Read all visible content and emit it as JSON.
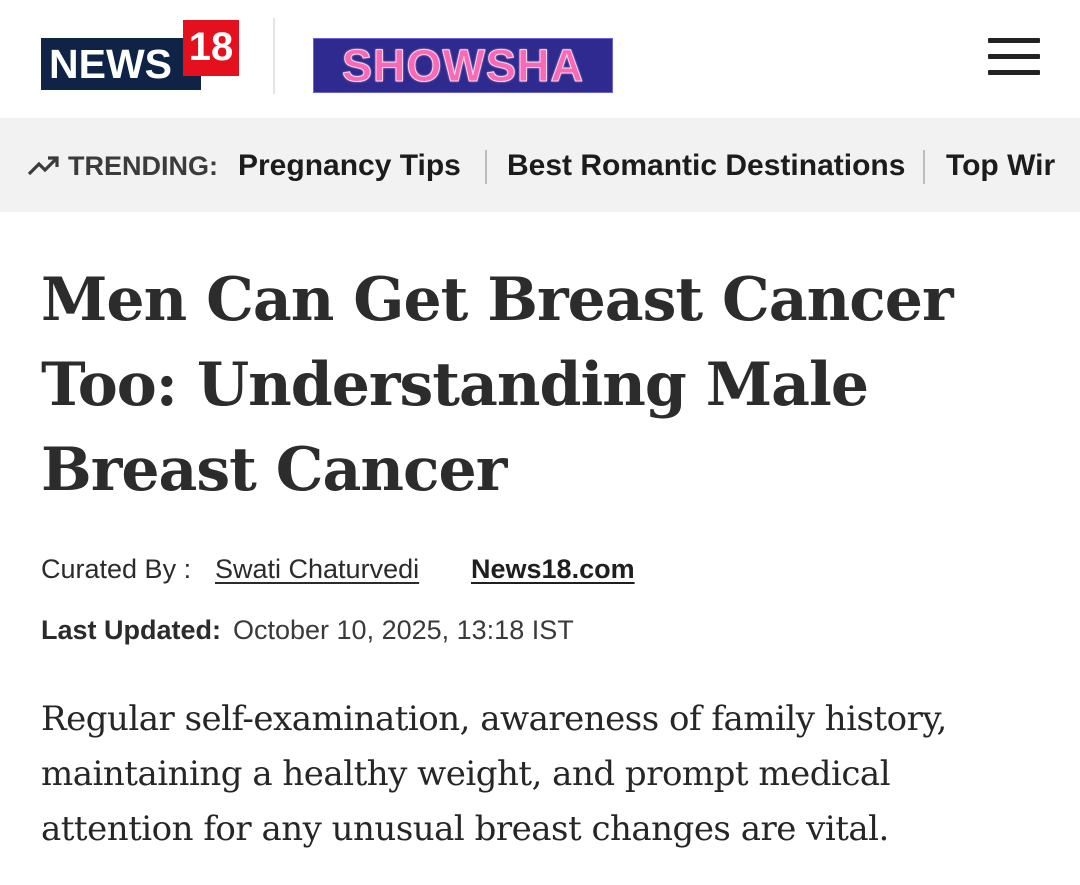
{
  "header": {
    "logo_news": "NEWS",
    "logo_number": "18",
    "logo_partner": "SHOWSHA"
  },
  "trending": {
    "label": "TRENDING:",
    "items": [
      "Pregnancy Tips",
      "Best Romantic Destinations",
      "Top Wir"
    ]
  },
  "article": {
    "headline": "Men Can Get Breast Cancer Too: Understanding Male Breast Cancer",
    "curated_label": "Curated By :",
    "author": "Swati Chaturvedi",
    "source": "News18.com",
    "updated_label": "Last Updated:",
    "updated_value": "October 10, 2025, 13:18 IST",
    "summary": "Regular self-examination, awareness of family history, maintaining a healthy weight, and prompt medical attention for any unusual breast changes are vital."
  },
  "colors": {
    "brand_navy": "#0f2346",
    "brand_red": "#e5101e",
    "showsha_bg": "#2f2a8f",
    "showsha_text": "#f86ab4",
    "trending_bg": "#f2f2f2"
  },
  "icons": {
    "menu": "hamburger-menu-icon",
    "trending": "trending-up-icon"
  }
}
